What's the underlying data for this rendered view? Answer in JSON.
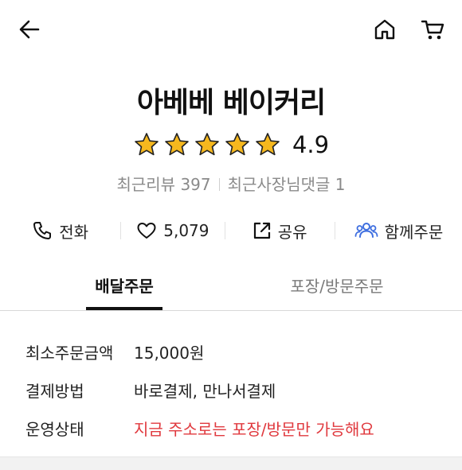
{
  "header": {
    "back_icon": "arrow-left-icon",
    "home_icon": "home-icon",
    "cart_icon": "cart-icon"
  },
  "store": {
    "name": "아베베 베이커리",
    "rating": "4.9",
    "star_count": 5,
    "star_color": "#f6b81e",
    "recent_reviews": "최근리뷰 397",
    "owner_replies": "최근사장님댓글 1"
  },
  "actions": {
    "call_label": "전화",
    "like_count": "5,079",
    "share_label": "공유",
    "group_order_label": "함께주문",
    "group_icon_color": "#3f6fe0"
  },
  "tabs": {
    "delivery": "배달주문",
    "pickup": "포장/방문주문"
  },
  "info": {
    "rows": [
      {
        "label": "최소주문금액",
        "value": "15,000원"
      },
      {
        "label": "결제방법",
        "value": "바로결제, 만나서결제"
      },
      {
        "label": "운영상태",
        "value": "지금 주소로는 포장/방문만 가능해요"
      }
    ],
    "warn_color": "#e0393e"
  }
}
